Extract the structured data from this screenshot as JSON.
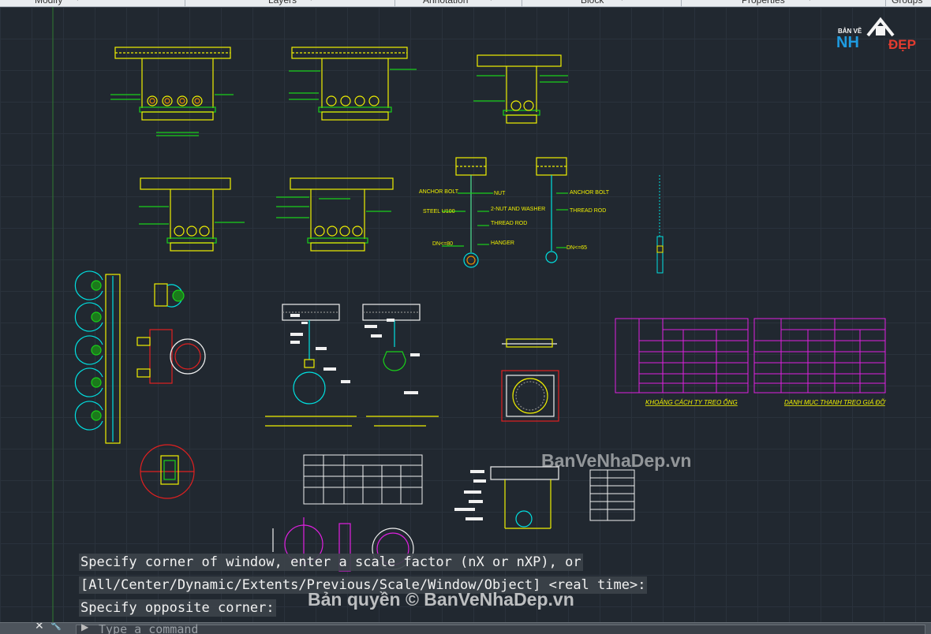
{
  "ribbon": {
    "panels": [
      {
        "label": "Modify"
      },
      {
        "label": "Layers"
      },
      {
        "label": "Annotation"
      },
      {
        "label": "Block"
      },
      {
        "label": "Properties"
      },
      {
        "label": "Groups"
      }
    ]
  },
  "logo": {
    "small": "BẢN VẼ",
    "nh": "NH",
    "dep": "ĐẸP"
  },
  "drawing": {
    "details": {
      "anchor_bolt": "ANCHOR BOLT",
      "nut": "NUT",
      "steel": "STEEL U100",
      "nut_washer": "2-NUT AND WASHER",
      "thread_rod": "THREAD ROD",
      "dn80": "DN<=80",
      "hanger": "HANGER",
      "anchor_bolt_2": "ANCHOR BOLT",
      "thread_rod_2": "THREAD ROD",
      "dn65": "DN<=65"
    },
    "tables": {
      "left_caption": "KHOẢNG CÁCH TY TREO ỐNG",
      "right_caption": "DANH MỤC THANH TREO GIÁ ĐỠ"
    }
  },
  "watermark": {
    "middle": "BanVeNhaDep.vn",
    "bottom": "Bản quyền © BanVeNhaDep.vn"
  },
  "command": {
    "history": [
      "Specify corner of window, enter a scale factor (nX or nXP), or",
      "[All/Center/Dynamic/Extents/Previous/Scale/Window/Object] <real time>:",
      "Specify opposite corner:"
    ],
    "placeholder": "Type a command"
  },
  "colors": {
    "background": "#212830",
    "yellow": "#f0f000",
    "green": "#19d019",
    "cyan": "#00e0e0",
    "magenta": "#e020e0",
    "red": "#e02020",
    "white": "#f0f0f0"
  },
  "icons": {
    "close": "close-icon",
    "wrench": "customize-icon",
    "prompt": "command-prompt-icon"
  }
}
